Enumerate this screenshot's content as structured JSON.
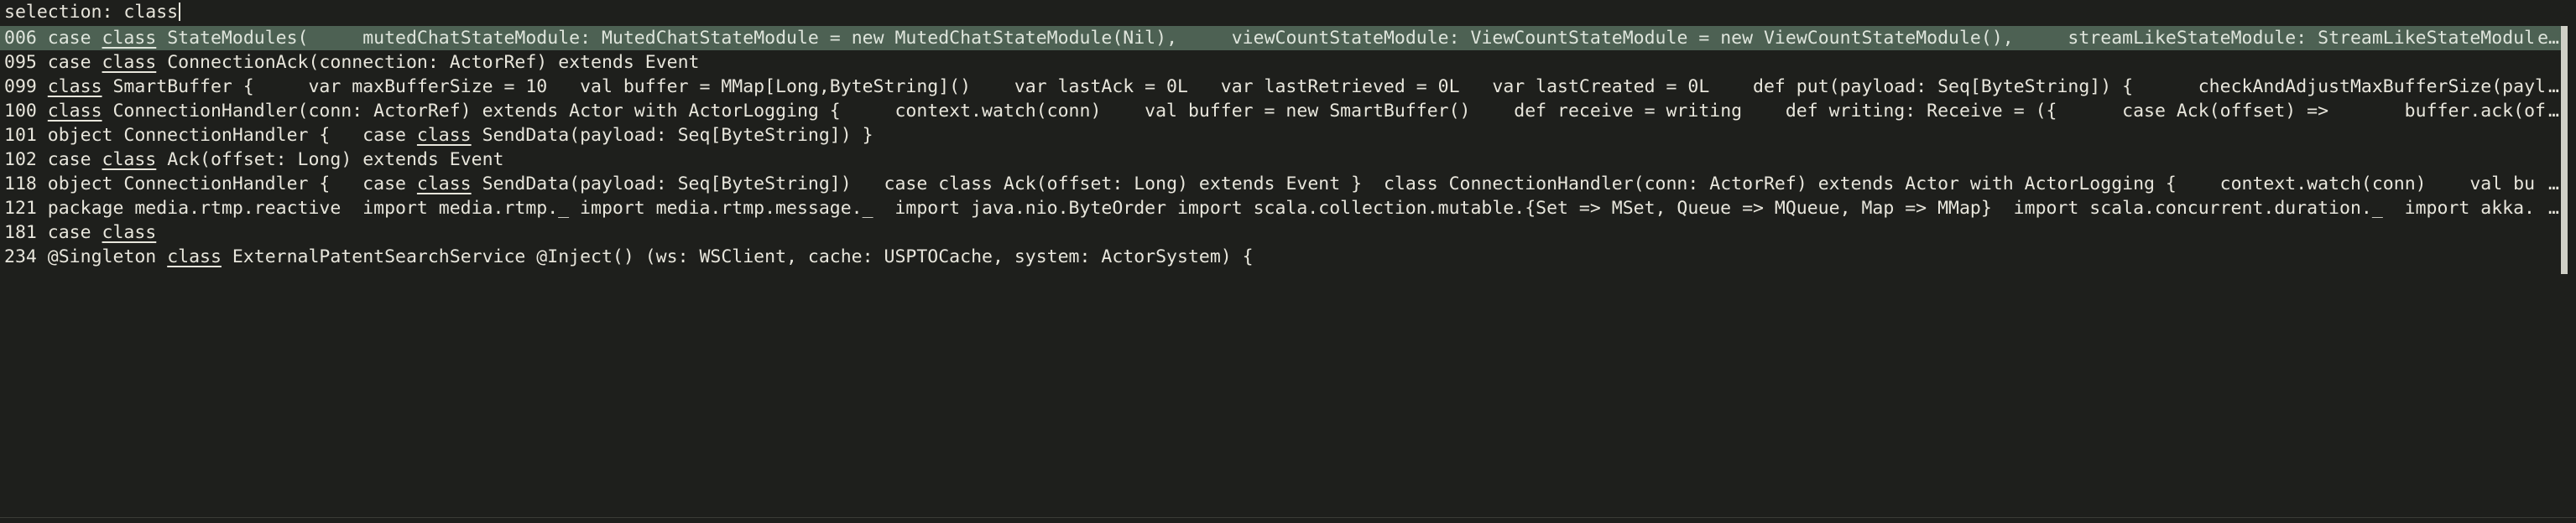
{
  "prompt": {
    "label": "selection:",
    "query": "class"
  },
  "results": [
    {
      "num": "006",
      "selected": true,
      "pre": "case ",
      "match": "class",
      "post": " StateModules(     mutedChatStateModule: MutedChatStateModule = new MutedChatStateModule(Nil),     viewCountStateModule: ViewCountStateModule = new ViewCountStateModule(),     streamLikeStateModule: StreamLikeStateModul",
      "ellipsis": "e…"
    },
    {
      "num": "095",
      "selected": false,
      "pre": "case ",
      "match": "class",
      "post": " ConnectionAck(connection: ActorRef) extends Event",
      "ellipsis": ""
    },
    {
      "num": "099",
      "selected": false,
      "pre": "",
      "match": "class",
      "post": " SmartBuffer {     var maxBufferSize = 10   val buffer = MMap[Long,ByteString]()    var lastAck = 0L   var lastRetrieved = 0L   var lastCreated = 0L    def put(payload: Seq[ByteString]) {      checkAndAdjustMaxBufferSize(paylo",
      "ellipsis": "…"
    },
    {
      "num": "100",
      "selected": false,
      "pre": "",
      "match": "class",
      "post": " ConnectionHandler(conn: ActorRef) extends Actor with ActorLogging {     context.watch(conn)    val buffer = new SmartBuffer()    def receive = writing    def writing: Receive = ({      case Ack(offset) =>       buffer.ack(off",
      "ellipsis": "…"
    },
    {
      "num": "101",
      "selected": false,
      "pre": "object ConnectionHandler {   case ",
      "match": "class",
      "post": " SendData(payload: Seq[ByteString]) }",
      "ellipsis": ""
    },
    {
      "num": "102",
      "selected": false,
      "pre": "case ",
      "match": "class",
      "post": " Ack(offset: Long) extends Event",
      "ellipsis": ""
    },
    {
      "num": "118",
      "selected": false,
      "pre": "object ConnectionHandler {   case ",
      "match": "class",
      "post": " SendData(payload: Seq[ByteString])   case class Ack(offset: Long) extends Event }  class ConnectionHandler(conn: ActorRef) extends Actor with ActorLogging {    context.watch(conn)    val bu",
      "ellipsis": "…"
    },
    {
      "num": "121",
      "selected": false,
      "pre": "package media.rtmp.reactive  import media.rtmp._ import media.rtmp.message._  import java.nio.ByteOrder import scala.collection.mutable.{Set => MSet, Queue => MQueue, Map => MMap}  import scala.concurrent.duration._  import akka.",
      "match": "",
      "post": "",
      "ellipsis": "…"
    },
    {
      "num": "181",
      "selected": false,
      "pre": "case ",
      "match": "class",
      "post": "",
      "ellipsis": ""
    },
    {
      "num": "234",
      "selected": false,
      "pre": "@Singleton ",
      "match": "class",
      "post": " ExternalPatentSearchService @Inject() (ws: WSClient, cache: USPTOCache, system: ActorSystem) {",
      "ellipsis": ""
    }
  ]
}
